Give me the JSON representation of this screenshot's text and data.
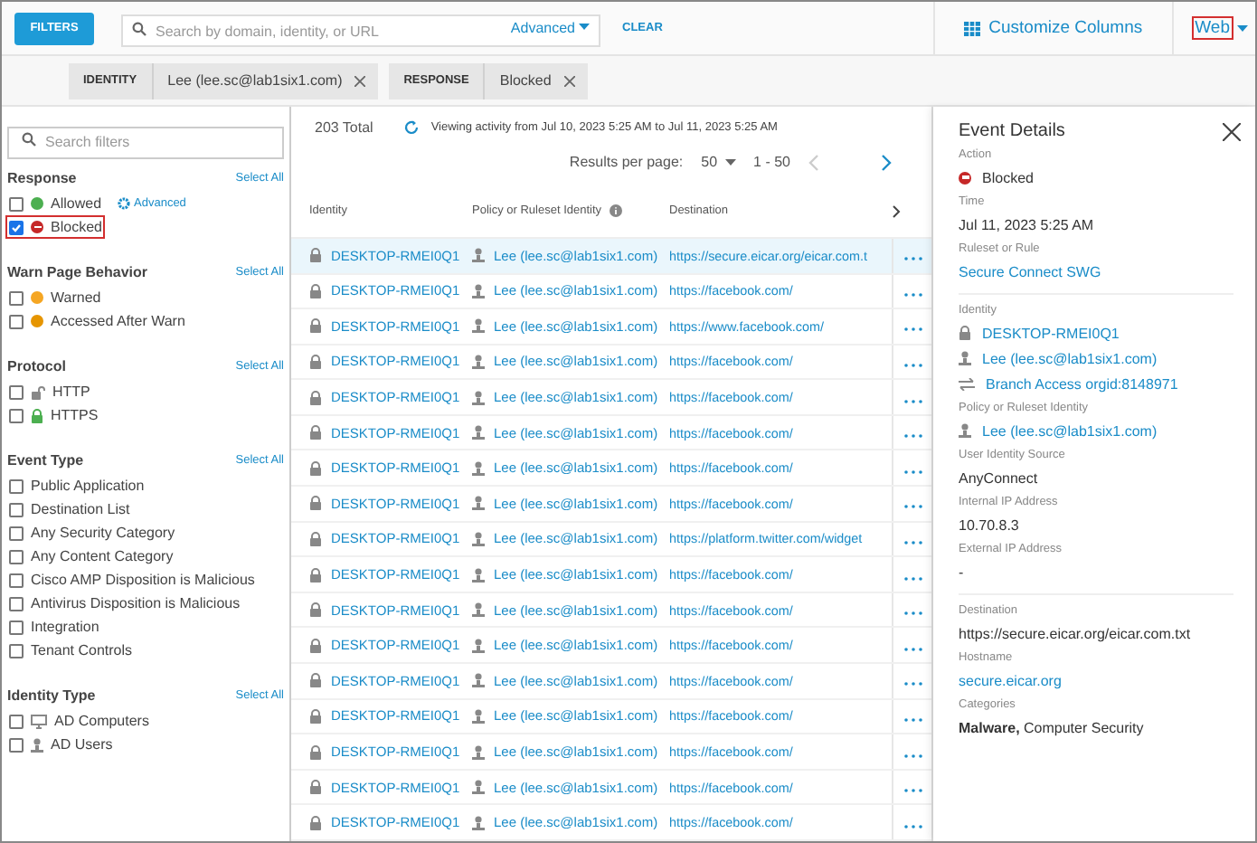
{
  "toolbar": {
    "filters_button": "FILTERS",
    "search": {
      "placeholder": "Search by domain, identity, or URL"
    },
    "advanced": "Advanced",
    "clear": "CLEAR",
    "customize": "Customize Columns",
    "view": {
      "label": "Web",
      "highlighted": true
    }
  },
  "chips": [
    {
      "key": "IDENTITY",
      "value": "Lee (lee.sc@lab1six1.com)"
    },
    {
      "key": "RESPONSE",
      "value": "Blocked"
    }
  ],
  "sidebar": {
    "search": {
      "placeholder": "Search filters"
    },
    "sections": [
      {
        "title": "Response",
        "select_all": "Select All",
        "advanced": "Advanced",
        "items": [
          {
            "label": "Allowed",
            "checked": false,
            "highlighted": false,
            "kind": "dot",
            "color": "#4caf50"
          },
          {
            "label": "Blocked",
            "checked": true,
            "highlighted": true,
            "kind": "blockdot",
            "color": "#c62828"
          }
        ]
      },
      {
        "title": "Warn Page Behavior",
        "select_all": "Select All",
        "items": [
          {
            "label": "Warned",
            "checked": false,
            "highlighted": false,
            "kind": "dot",
            "color": "#f5a623"
          },
          {
            "label": "Accessed After Warn",
            "checked": false,
            "highlighted": false,
            "kind": "dot",
            "color": "#e69500"
          }
        ]
      },
      {
        "title": "Protocol",
        "select_all": "Select All",
        "items": [
          {
            "label": "HTTP",
            "checked": false,
            "highlighted": false,
            "kind": "unlock"
          },
          {
            "label": "HTTPS",
            "checked": false,
            "highlighted": false,
            "kind": "lock"
          }
        ]
      },
      {
        "title": "Event Type",
        "select_all": "Select All",
        "items": [
          {
            "label": "Public Application",
            "checked": false,
            "highlighted": false,
            "kind": "plain"
          },
          {
            "label": "Destination List",
            "checked": false,
            "highlighted": false,
            "kind": "plain"
          },
          {
            "label": "Any Security Category",
            "checked": false,
            "highlighted": false,
            "kind": "plain"
          },
          {
            "label": "Any Content Category",
            "checked": false,
            "highlighted": false,
            "kind": "plain"
          },
          {
            "label": "Cisco AMP Disposition is Malicious",
            "checked": false,
            "highlighted": false,
            "kind": "plain"
          },
          {
            "label": "Antivirus Disposition is Malicious",
            "checked": false,
            "highlighted": false,
            "kind": "plain"
          },
          {
            "label": "Integration",
            "checked": false,
            "highlighted": false,
            "kind": "plain"
          },
          {
            "label": "Tenant Controls",
            "checked": false,
            "highlighted": false,
            "kind": "plain"
          }
        ]
      },
      {
        "title": "Identity Type",
        "select_all": "Select All",
        "items": [
          {
            "label": "AD Computers",
            "checked": false,
            "highlighted": false,
            "kind": "monitor"
          },
          {
            "label": "AD Users",
            "checked": false,
            "highlighted": false,
            "kind": "user"
          }
        ]
      }
    ]
  },
  "summary": {
    "total": "203 Total",
    "range_text": "Viewing activity from Jul 10, 2023 5:25 AM to Jul 11, 2023 5:25 AM",
    "per_page_label": "Results per page:",
    "per_page": "50",
    "page_range": "1 - 50"
  },
  "table": {
    "columns": [
      "Identity",
      "Policy or Ruleset Identity",
      "Destination"
    ],
    "rows": [
      {
        "identity": "DESKTOP-RMEI0Q1",
        "policy": "Lee (lee.sc@lab1six1.com)",
        "destination": "https://secure.eicar.org/eicar.com.t",
        "selected": true
      },
      {
        "identity": "DESKTOP-RMEI0Q1",
        "policy": "Lee (lee.sc@lab1six1.com)",
        "destination": "https://facebook.com/",
        "selected": false
      },
      {
        "identity": "DESKTOP-RMEI0Q1",
        "policy": "Lee (lee.sc@lab1six1.com)",
        "destination": "https://www.facebook.com/",
        "selected": false
      },
      {
        "identity": "DESKTOP-RMEI0Q1",
        "policy": "Lee (lee.sc@lab1six1.com)",
        "destination": "https://facebook.com/",
        "selected": false
      },
      {
        "identity": "DESKTOP-RMEI0Q1",
        "policy": "Lee (lee.sc@lab1six1.com)",
        "destination": "https://facebook.com/",
        "selected": false
      },
      {
        "identity": "DESKTOP-RMEI0Q1",
        "policy": "Lee (lee.sc@lab1six1.com)",
        "destination": "https://facebook.com/",
        "selected": false
      },
      {
        "identity": "DESKTOP-RMEI0Q1",
        "policy": "Lee (lee.sc@lab1six1.com)",
        "destination": "https://facebook.com/",
        "selected": false
      },
      {
        "identity": "DESKTOP-RMEI0Q1",
        "policy": "Lee (lee.sc@lab1six1.com)",
        "destination": "https://facebook.com/",
        "selected": false
      },
      {
        "identity": "DESKTOP-RMEI0Q1",
        "policy": "Lee (lee.sc@lab1six1.com)",
        "destination": "https://platform.twitter.com/widget",
        "selected": false
      },
      {
        "identity": "DESKTOP-RMEI0Q1",
        "policy": "Lee (lee.sc@lab1six1.com)",
        "destination": "https://facebook.com/",
        "selected": false
      },
      {
        "identity": "DESKTOP-RMEI0Q1",
        "policy": "Lee (lee.sc@lab1six1.com)",
        "destination": "https://facebook.com/",
        "selected": false
      },
      {
        "identity": "DESKTOP-RMEI0Q1",
        "policy": "Lee (lee.sc@lab1six1.com)",
        "destination": "https://facebook.com/",
        "selected": false
      },
      {
        "identity": "DESKTOP-RMEI0Q1",
        "policy": "Lee (lee.sc@lab1six1.com)",
        "destination": "https://facebook.com/",
        "selected": false
      },
      {
        "identity": "DESKTOP-RMEI0Q1",
        "policy": "Lee (lee.sc@lab1six1.com)",
        "destination": "https://facebook.com/",
        "selected": false
      },
      {
        "identity": "DESKTOP-RMEI0Q1",
        "policy": "Lee (lee.sc@lab1six1.com)",
        "destination": "https://facebook.com/",
        "selected": false
      },
      {
        "identity": "DESKTOP-RMEI0Q1",
        "policy": "Lee (lee.sc@lab1six1.com)",
        "destination": "https://facebook.com/",
        "selected": false
      },
      {
        "identity": "DESKTOP-RMEI0Q1",
        "policy": "Lee (lee.sc@lab1six1.com)",
        "destination": "https://facebook.com/",
        "selected": false
      }
    ]
  },
  "details": {
    "title": "Event Details",
    "sections": [
      [
        {
          "label": "Action",
          "values": [
            {
              "text": "Blocked",
              "kind": "status"
            }
          ]
        },
        {
          "label": "Time",
          "values": [
            {
              "text": "Jul 11, 2023 5:25 AM",
              "kind": "text"
            }
          ]
        },
        {
          "label": "Ruleset or Rule",
          "values": [
            {
              "text": "Secure Connect SWG",
              "kind": "link"
            }
          ]
        }
      ],
      [
        {
          "label": "Identity",
          "values": [
            {
              "text": "DESKTOP-RMEI0Q1",
              "kind": "lock"
            },
            {
              "text": "Lee (lee.sc@lab1six1.com)",
              "kind": "user"
            },
            {
              "text": "Branch Access orgid:8148971",
              "kind": "swap"
            }
          ]
        },
        {
          "label": "Policy or Ruleset Identity",
          "values": [
            {
              "text": "Lee (lee.sc@lab1six1.com)",
              "kind": "user"
            }
          ]
        },
        {
          "label": "User Identity Source",
          "values": [
            {
              "text": "AnyConnect",
              "kind": "text"
            }
          ]
        },
        {
          "label": "Internal IP Address",
          "values": [
            {
              "text": "10.70.8.3",
              "kind": "text"
            }
          ]
        },
        {
          "label": "External IP Address",
          "values": [
            {
              "text": "-",
              "kind": "text"
            }
          ]
        }
      ],
      [
        {
          "label": "Destination",
          "values": [
            {
              "text": "https://secure.eicar.org/eicar.com.txt",
              "kind": "text"
            }
          ]
        },
        {
          "label": "Hostname",
          "values": [
            {
              "text": "secure.eicar.org",
              "kind": "link"
            }
          ]
        },
        {
          "label": "Categories",
          "values": [
            {
              "text": "**Malware,** Computer Security",
              "kind": "text"
            }
          ]
        }
      ]
    ]
  }
}
